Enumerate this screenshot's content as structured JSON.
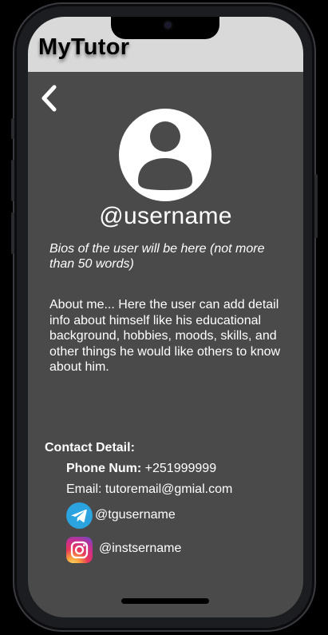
{
  "header": {
    "app_title": "MyTutor"
  },
  "profile": {
    "username": "@username",
    "bio": "Bios of the user will be here (not more than 50 words)",
    "about": "About me... Here the user can add detail info about himself like his educational background, hobbies, moods, skills, and other things he would like others to know about him."
  },
  "contact": {
    "heading": "Contact Detail:",
    "phone_label": "Phone Num:",
    "phone_value": " +251999999",
    "email_text": "Email: tutoremail@gmial.com",
    "telegram_handle": "@tgusername",
    "instagram_handle": "@instsername"
  },
  "icons": {
    "back": "chevron-left-icon",
    "avatar": "user-avatar-icon",
    "telegram": "telegram-icon",
    "instagram": "instagram-icon"
  },
  "colors": {
    "screen_background": "#4a4a4a",
    "header_background": "#d9d9d9",
    "text": "#ffffff",
    "telegram_blue": "#2aa3de"
  }
}
